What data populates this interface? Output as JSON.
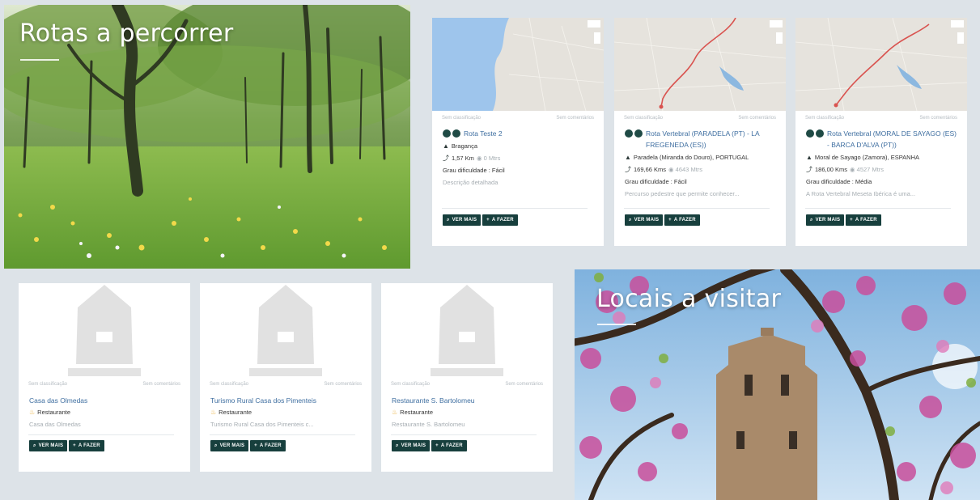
{
  "routes_section": {
    "title": "Rotas a percorrer"
  },
  "places_section": {
    "title": "Locais a visitar"
  },
  "common": {
    "no_rating": "Sem classificação",
    "no_comments": "Sem comentários",
    "view_more": "VER MAIS",
    "to_do": "A FAZER",
    "icons": {
      "view_more": "search-icon",
      "to_do": "plus-icon",
      "location": "mountain-icon",
      "distance": "route-icon",
      "altitude": "altitude-icon",
      "category": "restaurant-icon"
    }
  },
  "route_cards": [
    {
      "title": "Rota Teste 2",
      "location": "Bragança",
      "distance": "1,57 Km",
      "altitude": "0 Mtrs",
      "difficulty": "Grau dificuldade : Fácil",
      "description": "Descrição detalhada"
    },
    {
      "title": "Rota Vertebral (PARADELA (PT) - LA FREGENEDA (ES))",
      "location": "Paradela (Miranda do Douro), PORTUGAL",
      "distance": "169,66 Kms",
      "altitude": "4643 Mtrs",
      "difficulty": "Grau dificuldade : Fácil",
      "description": "Percurso pedestre que permite conhecer..."
    },
    {
      "title": "Rota Vertebral (MORAL DE SAYAGO (ES) - BARCA D'ALVA (PT))",
      "location": "Moral de Sayago (Zamora), ESPANHA",
      "distance": "186,00 Kms",
      "altitude": "4527 Mtrs",
      "difficulty": "Grau dificuldade : Média",
      "description": "A Rota Vertebral Meseta Ibérica é uma..."
    }
  ],
  "place_cards": [
    {
      "title": "Casa das Olmedas",
      "category": "Restaurante",
      "description": "Casa das Olmedas"
    },
    {
      "title": "Turismo Rural Casa dos Pimenteis",
      "category": "Restaurante",
      "description": "Turismo Rural Casa dos Pimenteis c..."
    },
    {
      "title": "Restaurante S. Bartolomeu",
      "category": "Restaurante",
      "description": "Restaurante S. Bartolomeu"
    }
  ],
  "colors": {
    "page_bg": "#dde3e8",
    "button_bg": "#173f3d",
    "link": "#3e6ea0",
    "route_line": "#d9534f"
  }
}
